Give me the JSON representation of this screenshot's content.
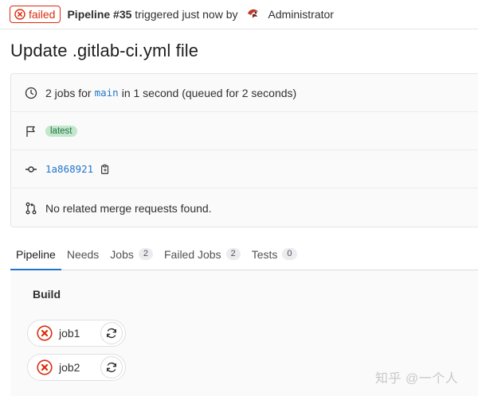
{
  "header": {
    "status": "failed",
    "pipeline": "Pipeline #35",
    "triggered": "triggered just now by",
    "user": "Administrator"
  },
  "title": "Update .gitlab-ci.yml file",
  "info": {
    "jobs_prefix": "2 jobs for",
    "branch": "main",
    "jobs_suffix": "in 1 second (queued for 2 seconds)",
    "tag": "latest",
    "commit": "1a868921",
    "merge_requests": "No related merge requests found."
  },
  "tabs": [
    {
      "label": "Pipeline",
      "count": ""
    },
    {
      "label": "Needs",
      "count": ""
    },
    {
      "label": "Jobs",
      "count": "2"
    },
    {
      "label": "Failed Jobs",
      "count": "2"
    },
    {
      "label": "Tests",
      "count": "0"
    }
  ],
  "graph": {
    "stage": "Build",
    "jobs": [
      {
        "name": "job1",
        "status": "failed"
      },
      {
        "name": "job2",
        "status": "failed"
      }
    ]
  },
  "watermark": "知乎 @一个人",
  "colors": {
    "failed": "#dd2b0e",
    "link": "#1f75cb",
    "tag_bg": "#c3e6cd"
  }
}
